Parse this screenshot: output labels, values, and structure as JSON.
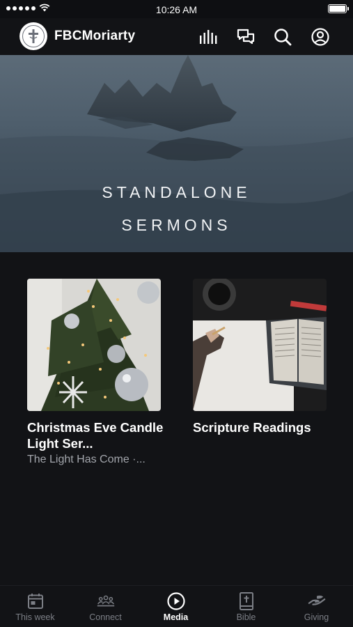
{
  "status_bar": {
    "time": "10:26 AM"
  },
  "header": {
    "app_name": "FBCMoriarty",
    "icons": [
      "audio-bars-icon",
      "chat-icon",
      "search-icon",
      "profile-icon"
    ]
  },
  "hero": {
    "title_line1": "STANDALONE",
    "title_line2": "SERMONS"
  },
  "cards": [
    {
      "title": "Christmas Eve Candle Light Ser...",
      "subtitle": "The Light Has Come ·..."
    },
    {
      "title": "Scripture Readings"
    }
  ],
  "tabs": [
    {
      "label": "This week",
      "icon": "calendar-icon",
      "active": false
    },
    {
      "label": "Connect",
      "icon": "people-icon",
      "active": false
    },
    {
      "label": "Media",
      "icon": "play-icon",
      "active": true
    },
    {
      "label": "Bible",
      "icon": "bible-icon",
      "active": false
    },
    {
      "label": "Giving",
      "icon": "giving-hand-icon",
      "active": false
    }
  ],
  "colors": {
    "background": "#121316",
    "tab_inactive": "#7c7f86",
    "tab_active": "#ffffff",
    "subtitle": "#a3a6ac"
  }
}
